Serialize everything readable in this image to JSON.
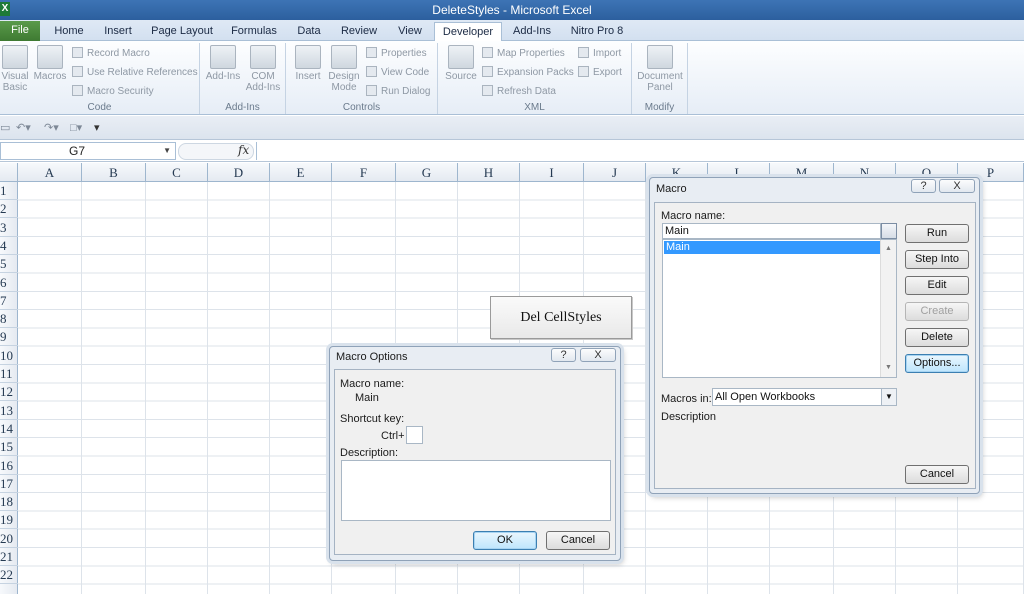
{
  "window": {
    "title": "DeleteStyles  -  Microsoft Excel",
    "app_icon": "X"
  },
  "tabs": [
    {
      "label": "File"
    },
    {
      "label": "Home"
    },
    {
      "label": "Insert"
    },
    {
      "label": "Page Layout"
    },
    {
      "label": "Formulas"
    },
    {
      "label": "Data"
    },
    {
      "label": "Review"
    },
    {
      "label": "View"
    },
    {
      "label": "Developer",
      "active": true
    },
    {
      "label": "Add-Ins"
    },
    {
      "label": "Nitro Pro 8"
    }
  ],
  "ribbon": {
    "code": {
      "label": "Code",
      "visual_basic_1": "Visual",
      "visual_basic_2": "Basic",
      "macros": "Macros",
      "record_macro": "Record Macro",
      "use_relative": "Use Relative References",
      "macro_security": "Macro Security"
    },
    "addins": {
      "label": "Add-Ins",
      "addins": "Add-Ins",
      "com_1": "COM",
      "com_2": "Add-Ins"
    },
    "controls": {
      "label": "Controls",
      "insert": "Insert",
      "design_1": "Design",
      "design_2": "Mode",
      "properties": "Properties",
      "view_code": "View Code",
      "run_dialog": "Run Dialog"
    },
    "xml": {
      "label": "XML",
      "source": "Source",
      "map_properties": "Map Properties",
      "expansion_packs": "Expansion Packs",
      "refresh_data": "Refresh Data",
      "import": "Import",
      "export": "Export"
    },
    "modify": {
      "label": "Modify",
      "doc_1": "Document",
      "doc_2": "Panel"
    }
  },
  "formula_bar": {
    "name_box": "G7",
    "fx": "fx",
    "value": ""
  },
  "columns": [
    "A",
    "B",
    "C",
    "D",
    "E",
    "F",
    "G",
    "H",
    "I",
    "J",
    "K",
    "L",
    "M",
    "N",
    "O",
    "P"
  ],
  "rows": [
    "1",
    "2",
    "3",
    "4",
    "5",
    "6",
    "7",
    "8",
    "9",
    "10",
    "11",
    "12",
    "13",
    "14",
    "15",
    "16",
    "17",
    "18",
    "19",
    "20",
    "21",
    "22"
  ],
  "sheet_button": {
    "label": "Del CellStyles"
  },
  "macro_dialog": {
    "title": "Macro",
    "help": "?",
    "close": "X",
    "macro_name_label": "Macro name:",
    "macro_name_value": "Main",
    "list_items": [
      "Main"
    ],
    "macros_in_label": "Macros in:",
    "macros_in_value": "All Open Workbooks",
    "description_label": "Description",
    "buttons": {
      "run": "Run",
      "step_into": "Step Into",
      "edit": "Edit",
      "create": "Create",
      "delete": "Delete",
      "options": "Options...",
      "cancel": "Cancel"
    }
  },
  "options_dialog": {
    "title": "Macro Options",
    "help": "?",
    "close": "X",
    "macro_name_label": "Macro name:",
    "macro_name_value": "Main",
    "shortcut_label": "Shortcut key:",
    "ctrl_label": "Ctrl+",
    "shortcut_value": "",
    "description_label": "Description:",
    "description_value": "",
    "ok": "OK",
    "cancel": "Cancel"
  }
}
